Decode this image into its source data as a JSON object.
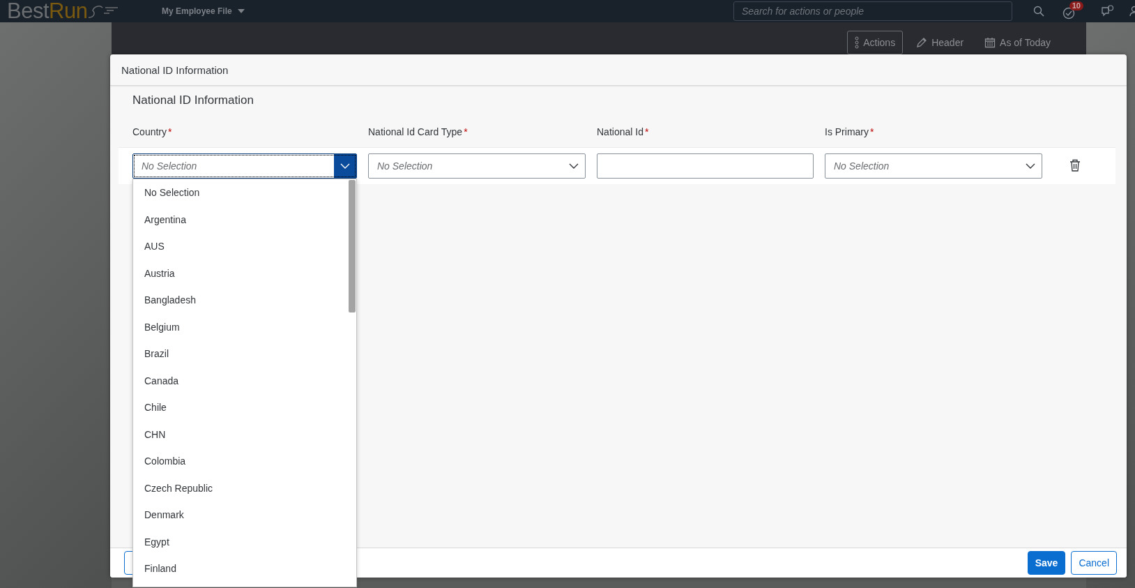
{
  "top_bar": {
    "logo": {
      "first": "Best",
      "second": "Run"
    },
    "nav": "My Employee File",
    "search": {
      "placeholder": "Search for actions or people"
    },
    "notifications_badge": "10"
  },
  "header_actions": [
    {
      "label": "Actions",
      "kind": "dots",
      "outlined": true
    },
    {
      "label": "Header",
      "kind": "pencil",
      "outlined": false
    },
    {
      "label": "As of Today",
      "kind": "calendar",
      "outlined": false
    }
  ],
  "dialog": {
    "title": "National ID Information",
    "section_title": "National ID Information",
    "columns": [
      {
        "label": "Country",
        "required_mark": "*"
      },
      {
        "label": "National Id Card Type",
        "required_mark": "*"
      },
      {
        "label": "National Id",
        "required_mark": "*"
      },
      {
        "label": "Is Primary",
        "required_mark": "*"
      }
    ],
    "fields": [
      {
        "kind": "select",
        "placeholder": "No Selection",
        "focused": true
      },
      {
        "kind": "select",
        "placeholder": "No Selection",
        "focused": false
      },
      {
        "kind": "text",
        "focused": false
      },
      {
        "kind": "select",
        "placeholder": "No Selection",
        "focused": false
      }
    ],
    "dropdown": {
      "items": [
        {
          "label": "No Selection",
          "selected": false
        },
        {
          "label": "Argentina",
          "selected": false
        },
        {
          "label": "AUS",
          "selected": false
        },
        {
          "label": "Austria",
          "selected": false
        },
        {
          "label": "Bangladesh",
          "selected": false
        },
        {
          "label": "Belgium",
          "selected": false
        },
        {
          "label": "Brazil",
          "selected": false
        },
        {
          "label": "Canada",
          "selected": false
        },
        {
          "label": "Chile",
          "selected": false
        },
        {
          "label": "CHN",
          "selected": false
        },
        {
          "label": "Colombia",
          "selected": false
        },
        {
          "label": "Czech Republic",
          "selected": false
        },
        {
          "label": "Denmark",
          "selected": false
        },
        {
          "label": "Egypt",
          "selected": false
        },
        {
          "label": "Finland",
          "selected": false
        }
      ]
    },
    "buttons": [
      {
        "label": "Save",
        "kind": "primary"
      },
      {
        "label": "Cancel",
        "kind": "secondary"
      }
    ]
  }
}
